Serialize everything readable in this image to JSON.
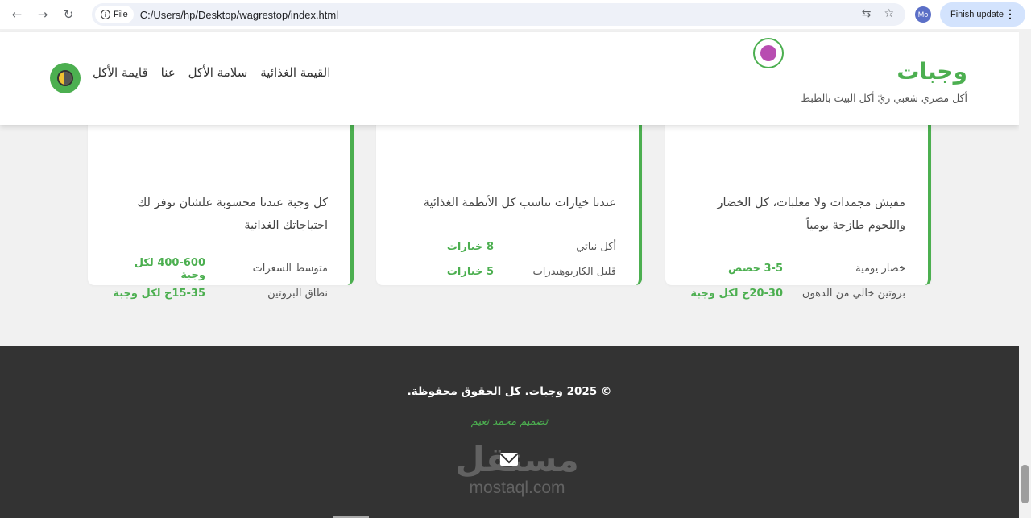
{
  "browser": {
    "file_chip": "File",
    "url": "C:/Users/hp/Desktop/wagrestop/index.html",
    "profile_initials": "Mo",
    "update_label": "Finish update"
  },
  "header": {
    "brand": "وجبات",
    "tagline": "أكل مصري شعبي زيّ أكل البيت بالظبط",
    "nav": [
      "قايمة الأكل",
      "عنا",
      "سلامة الأكل",
      "القيمة الغذائية"
    ]
  },
  "cards": [
    {
      "desc": "مفيش مجمدات ولا معلبات، كل الخضار واللحوم طازجة يومياً",
      "rows": [
        {
          "label": "خضار يومية",
          "value": "3-5 حصص"
        },
        {
          "label": "بروتين خالي من الدهون",
          "value": "20-30ج لكل وجبة"
        }
      ]
    },
    {
      "desc": "عندنا خيارات تناسب كل الأنظمة الغذائية",
      "rows": [
        {
          "label": "أكل نباتي",
          "value": "8 خيارات"
        },
        {
          "label": "قليل الكاربوهيدرات",
          "value": "5 خيارات"
        }
      ]
    },
    {
      "desc": "كل وجبة عندنا محسوبة علشان توفر لك احتياجاتك الغذائية",
      "rows": [
        {
          "label": "متوسط السعرات",
          "value": "400-600 لكل وجبة"
        },
        {
          "label": "نطاق البروتين",
          "value": "15-35ج لكل وجبة"
        }
      ]
    }
  ],
  "footer": {
    "copyright": "© 2025 وجبات. كل الحقوق محفوظة.",
    "designer": "تصميم محمد نعيم"
  },
  "watermark": {
    "arabic": "مستقل",
    "latin": "mostaql.com"
  },
  "colors": {
    "accent": "#4caf50",
    "footer_bg": "#333333",
    "brand_icon_fill": "#b84db1"
  }
}
